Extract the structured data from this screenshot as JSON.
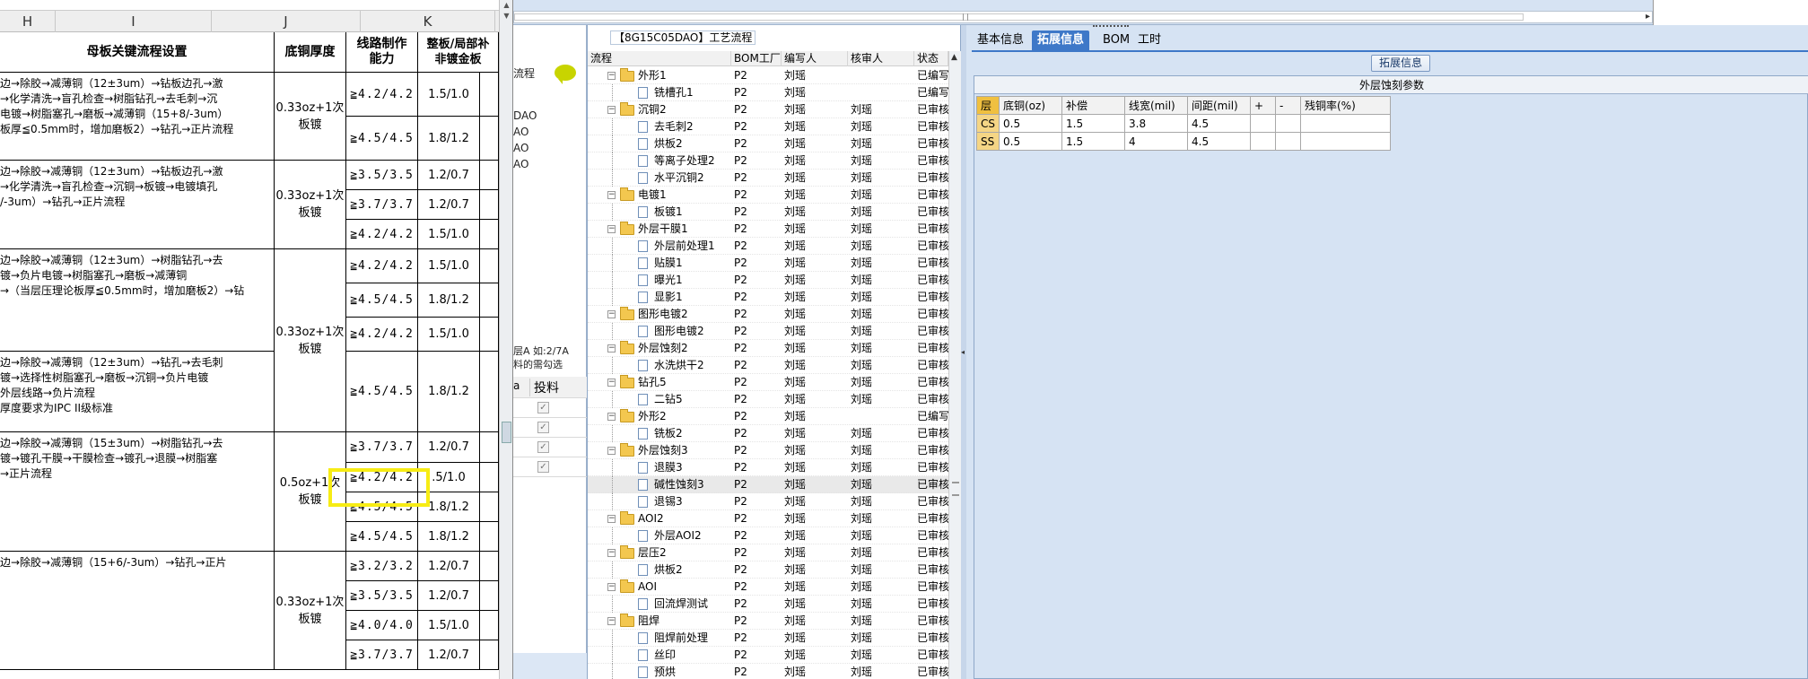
{
  "spreadsheet": {
    "columns": [
      "H",
      "I",
      "J",
      "K"
    ],
    "headers": {
      "process": "母板关键流程设置",
      "base_copper": "底铜厚度",
      "line_capability_1": "线路制作",
      "line_capability_2": "能力",
      "plating_1": "整板/局部补",
      "plating_2": "非镀金板"
    },
    "groups": [
      {
        "process": "边→除胶→减薄铜（12±3um）→钻板边孔→激\n→化学清洗→盲孔检查→树脂钻孔→去毛刺→沉\n电镀→树脂塞孔→磨板→减薄铜（15+8/-3um）\n板厚≦0.5mm时，增加磨板2）→钻孔→正片流程",
        "base_copper": "0.33oz+1次\n板镀",
        "rows": [
          [
            "≧4.2/4.2",
            "1.5/1.0"
          ],
          [
            "≧4.5/4.5",
            "1.8/1.2"
          ]
        ]
      },
      {
        "process": "边→除胶→减薄铜（12±3um）→钻板边孔→激\n→化学清洗→盲孔检查→沉铜→板镀→电镀填孔\n/-3um）→钻孔→正片流程",
        "base_copper": "0.33oz+1次\n板镀",
        "rows": [
          [
            "≧3.5/3.5",
            "1.2/0.7"
          ],
          [
            "≧3.7/3.7",
            "1.2/0.7"
          ],
          [
            "≧4.2/4.2",
            "1.5/1.0"
          ]
        ]
      },
      {
        "process": "边→除胶→减薄铜（12±3um）→树脂钻孔→去\n镀→负片电镀→树脂塞孔→磨板→减薄铜\n→（当层压理论板厚≦0.5mm时，增加磨板2）→钻",
        "base_copper": "0.33oz+1次\n板镀",
        "rows": [
          [
            "≧4.2/4.2",
            "1.5/1.0"
          ],
          [
            "≧4.5/4.5",
            "1.8/1.2"
          ],
          [
            "≧4.2/4.2",
            "1.5/1.0"
          ]
        ]
      },
      {
        "process": "边→除胶→减薄铜（12±3um）→钻孔→去毛刺\n镀→选择性树脂塞孔→磨板→沉铜→负片电镀\n外层线路→负片流程\n厚度要求为IPC II级标准",
        "rows": [
          [
            "≧4.5/4.5",
            "1.8/1.2"
          ]
        ]
      },
      {
        "process": "边→除胶→减薄铜（15±3um）→树脂钻孔→去\n镀→镀孔干膜→干膜检查→镀孔→退膜→树脂塞\n→正片流程",
        "base_copper": "0.5oz+1次\n板镀",
        "rows": [
          [
            "≧3.7/3.7",
            "1.2/0.7"
          ],
          [
            "≧4.2/4.2",
            ".5/1.0"
          ],
          [
            "≧4.5/4.5",
            "1.8/1.2"
          ],
          [
            "≧4.5/4.5",
            "1.8/1.2"
          ]
        ]
      },
      {
        "process": "边→除胶→减薄铜（15+6/-3um）→钻孔→正片",
        "base_copper": "0.33oz+1次\n板镀",
        "rows": [
          [
            "≧3.2/3.2",
            "1.2/0.7"
          ],
          [
            "≧3.5/3.5",
            "1.2/0.7"
          ],
          [
            "≧4.0/4.0",
            "1.5/1.0"
          ],
          [
            "≧3.7/3.7",
            "1.2/0.7"
          ]
        ]
      }
    ]
  },
  "midleft": {
    "flow_label": "流程",
    "codes": [
      "DAO",
      "AO",
      "AO",
      "AO"
    ],
    "note_1": "层A 如:2/7A",
    "note_2": "料的需勾选",
    "feed_header": "投料",
    "feed_prefix": "a"
  },
  "process_panel": {
    "title": "【8G15C05DAO】工艺流程",
    "headers": [
      "流程",
      "BOM工厂",
      "编写人",
      "核审人",
      "状态"
    ],
    "rows": [
      {
        "level": 0,
        "name": "外形1",
        "factory": "P2",
        "writer": "刘瑶",
        "reviewer": "",
        "status": "已编写"
      },
      {
        "level": 1,
        "name": "铣槽孔1",
        "factory": "P2",
        "writer": "刘瑶",
        "reviewer": "",
        "status": "已编写"
      },
      {
        "level": 0,
        "name": "沉铜2",
        "factory": "P2",
        "writer": "刘瑶",
        "reviewer": "刘瑶",
        "status": "已审核"
      },
      {
        "level": 1,
        "name": "去毛刺2",
        "factory": "P2",
        "writer": "刘瑶",
        "reviewer": "刘瑶",
        "status": "已审核"
      },
      {
        "level": 1,
        "name": "烘板2",
        "factory": "P2",
        "writer": "刘瑶",
        "reviewer": "刘瑶",
        "status": "已审核"
      },
      {
        "level": 1,
        "name": "等离子处理2",
        "factory": "P2",
        "writer": "刘瑶",
        "reviewer": "刘瑶",
        "status": "已审核"
      },
      {
        "level": 1,
        "name": "水平沉铜2",
        "factory": "P2",
        "writer": "刘瑶",
        "reviewer": "刘瑶",
        "status": "已审核"
      },
      {
        "level": 0,
        "name": "电镀1",
        "factory": "P2",
        "writer": "刘瑶",
        "reviewer": "刘瑶",
        "status": "已审核"
      },
      {
        "level": 1,
        "name": "板镀1",
        "factory": "P2",
        "writer": "刘瑶",
        "reviewer": "刘瑶",
        "status": "已审核"
      },
      {
        "level": 0,
        "name": "外层干膜1",
        "factory": "P2",
        "writer": "刘瑶",
        "reviewer": "刘瑶",
        "status": "已审核"
      },
      {
        "level": 1,
        "name": "外层前处理1",
        "factory": "P2",
        "writer": "刘瑶",
        "reviewer": "刘瑶",
        "status": "已审核"
      },
      {
        "level": 1,
        "name": "贴膜1",
        "factory": "P2",
        "writer": "刘瑶",
        "reviewer": "刘瑶",
        "status": "已审核"
      },
      {
        "level": 1,
        "name": "曝光1",
        "factory": "P2",
        "writer": "刘瑶",
        "reviewer": "刘瑶",
        "status": "已审核"
      },
      {
        "level": 1,
        "name": "显影1",
        "factory": "P2",
        "writer": "刘瑶",
        "reviewer": "刘瑶",
        "status": "已审核"
      },
      {
        "level": 0,
        "name": "图形电镀2",
        "factory": "P2",
        "writer": "刘瑶",
        "reviewer": "刘瑶",
        "status": "已审核"
      },
      {
        "level": 1,
        "name": "图形电镀2",
        "factory": "P2",
        "writer": "刘瑶",
        "reviewer": "刘瑶",
        "status": "已审核"
      },
      {
        "level": 0,
        "name": "外层蚀刻2",
        "factory": "P2",
        "writer": "刘瑶",
        "reviewer": "刘瑶",
        "status": "已审核"
      },
      {
        "level": 1,
        "name": "水洗烘干2",
        "factory": "P2",
        "writer": "刘瑶",
        "reviewer": "刘瑶",
        "status": "已审核"
      },
      {
        "level": 0,
        "name": "钻孔5",
        "factory": "P2",
        "writer": "刘瑶",
        "reviewer": "刘瑶",
        "status": "已审核"
      },
      {
        "level": 1,
        "name": "二钻5",
        "factory": "P2",
        "writer": "刘瑶",
        "reviewer": "刘瑶",
        "status": "已审核"
      },
      {
        "level": 0,
        "name": "外形2",
        "factory": "P2",
        "writer": "刘瑶",
        "reviewer": "",
        "status": "已编写"
      },
      {
        "level": 1,
        "name": "铣板2",
        "factory": "P2",
        "writer": "刘瑶",
        "reviewer": "刘瑶",
        "status": "已审核"
      },
      {
        "level": 0,
        "name": "外层蚀刻3",
        "factory": "P2",
        "writer": "刘瑶",
        "reviewer": "刘瑶",
        "status": "已审核"
      },
      {
        "level": 1,
        "name": "退膜3",
        "factory": "P2",
        "writer": "刘瑶",
        "reviewer": "刘瑶",
        "status": "已审核"
      },
      {
        "level": 1,
        "name": "碱性蚀刻3",
        "factory": "P2",
        "writer": "刘瑶",
        "reviewer": "刘瑶",
        "status": "已审核",
        "selected": true
      },
      {
        "level": 1,
        "name": "退锡3",
        "factory": "P2",
        "writer": "刘瑶",
        "reviewer": "刘瑶",
        "status": "已审核"
      },
      {
        "level": 0,
        "name": "AOI2",
        "factory": "P2",
        "writer": "刘瑶",
        "reviewer": "刘瑶",
        "status": "已审核"
      },
      {
        "level": 1,
        "name": "外层AOI2",
        "factory": "P2",
        "writer": "刘瑶",
        "reviewer": "刘瑶",
        "status": "已审核"
      },
      {
        "level": 0,
        "name": "层压2",
        "factory": "P2",
        "writer": "刘瑶",
        "reviewer": "刘瑶",
        "status": "已审核"
      },
      {
        "level": 1,
        "name": "烘板2",
        "factory": "P2",
        "writer": "刘瑶",
        "reviewer": "刘瑶",
        "status": "已审核"
      },
      {
        "level": 0,
        "name": "AOI",
        "factory": "P2",
        "writer": "刘瑶",
        "reviewer": "刘瑶",
        "status": "已审核"
      },
      {
        "level": 1,
        "name": "回流焊测试",
        "factory": "P2",
        "writer": "刘瑶",
        "reviewer": "刘瑶",
        "status": "已审核"
      },
      {
        "level": 0,
        "name": "阻焊",
        "factory": "P2",
        "writer": "刘瑶",
        "reviewer": "刘瑶",
        "status": "已审核"
      },
      {
        "level": 1,
        "name": "阻焊前处理",
        "factory": "P2",
        "writer": "刘瑶",
        "reviewer": "刘瑶",
        "status": "已审核"
      },
      {
        "level": 1,
        "name": "丝印",
        "factory": "P2",
        "writer": "刘瑶",
        "reviewer": "刘瑶",
        "status": "已审核"
      },
      {
        "level": 1,
        "name": "预烘",
        "factory": "P2",
        "writer": "刘瑶",
        "reviewer": "刘瑶",
        "status": "已审核"
      }
    ]
  },
  "right_panel": {
    "tabs": [
      "基本信息",
      "拓展信息",
      "BOM",
      "工时"
    ],
    "active_tab": 1,
    "ext_button": "拓展信息",
    "section_title": "外层蚀刻参数",
    "table_headers": [
      "层",
      "底铜(oz)",
      "补偿",
      "线宽(mil)",
      "间距(mil)",
      "+",
      "-",
      "残铜率(%)"
    ],
    "table_rows": [
      [
        "CS",
        "0.5",
        "1.5",
        "3.8",
        "4.5",
        "",
        "",
        ""
      ],
      [
        "SS",
        "0.5",
        "1.5",
        "4",
        "4.5",
        "",
        "",
        ""
      ]
    ]
  },
  "colors": {
    "highlight": "#f7ec14",
    "active_tab": "#3e78c8",
    "panel_bg": "#d6e3f3"
  }
}
